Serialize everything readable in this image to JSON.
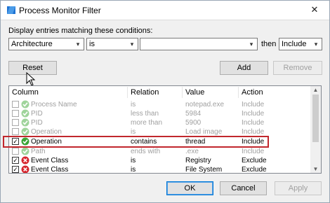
{
  "window": {
    "title": "Process Monitor Filter",
    "close_glyph": "✕"
  },
  "conditions_label": "Display entries matching these conditions:",
  "filter_row": {
    "column_value": "Architecture",
    "relation_value": "is",
    "value_value": "",
    "then_label": "then",
    "action_value": "Include"
  },
  "buttons": {
    "reset": "Reset",
    "add": "Add",
    "remove": "Remove",
    "ok": "OK",
    "cancel": "Cancel",
    "apply": "Apply"
  },
  "table": {
    "headers": [
      "Column",
      "Relation",
      "Value",
      "Action"
    ],
    "rows": [
      {
        "checked": false,
        "icon": "check-icon",
        "column": "Process Name",
        "relation": "is",
        "value": "notepad.exe",
        "action": "Include",
        "enabled": false
      },
      {
        "checked": false,
        "icon": "check-icon",
        "column": "PID",
        "relation": "less than",
        "value": "5984",
        "action": "Include",
        "enabled": false
      },
      {
        "checked": false,
        "icon": "check-icon",
        "column": "PID",
        "relation": "more than",
        "value": "5900",
        "action": "Include",
        "enabled": false
      },
      {
        "checked": false,
        "icon": "check-icon",
        "column": "Operation",
        "relation": "is",
        "value": "Load image",
        "action": "Include",
        "enabled": false
      },
      {
        "checked": true,
        "icon": "check-icon",
        "column": "Operation",
        "relation": "contains",
        "value": "thread",
        "action": "Include",
        "enabled": true
      },
      {
        "checked": false,
        "icon": "check-icon",
        "column": "Path",
        "relation": "ends with",
        "value": ".exe",
        "action": "Include",
        "enabled": false
      },
      {
        "checked": true,
        "icon": "cross-icon",
        "column": "Event Class",
        "relation": "is",
        "value": "Registry",
        "action": "Exclude",
        "enabled": true
      },
      {
        "checked": true,
        "icon": "cross-icon",
        "column": "Event Class",
        "relation": "is",
        "value": "File System",
        "action": "Exclude",
        "enabled": true
      }
    ]
  },
  "colors": {
    "highlight_border": "#c1272d",
    "include_icon": "#3aa535",
    "exclude_icon": "#d7262d",
    "disabled_text": "#a0a0a0"
  }
}
